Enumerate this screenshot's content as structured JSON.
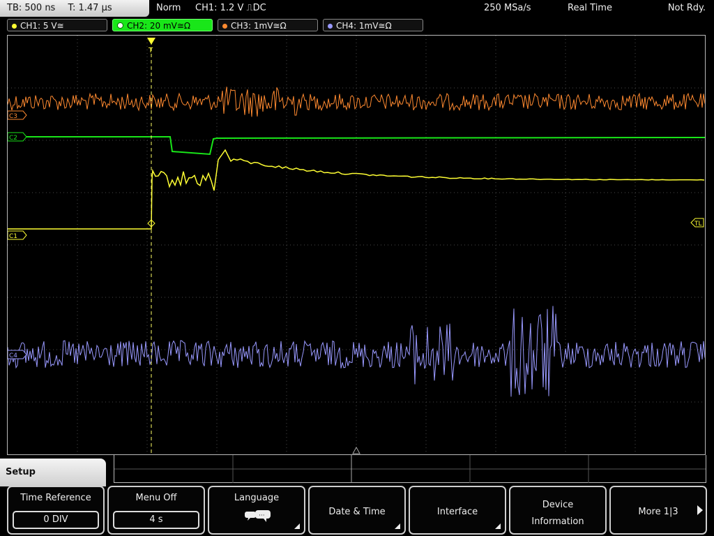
{
  "status": {
    "timebase": "TB: 500 ns",
    "time": "T: 1.47 µs",
    "mode": "Norm",
    "trigger": "CH1: 1.2 V ⎍DC",
    "sample_rate": "250 MSa/s",
    "acq_mode": "Real Time",
    "state": "Not Rdy."
  },
  "channels": [
    {
      "label": "CH1: 5 V≅",
      "color": "#ffff33"
    },
    {
      "label": "CH2: 20 mV≅Ω",
      "color": "#19e619"
    },
    {
      "label": "CH3: 1mV≅Ω",
      "color": "#ff8a30"
    },
    {
      "label": "CH4: 1mV≅Ω",
      "color": "#9999ff"
    }
  ],
  "markers": {
    "c3": "C3",
    "c2": "C2",
    "c1": "C1",
    "c4": "C4",
    "trigger_level": "TL",
    "trigger_position": "T"
  },
  "menu": {
    "title": "Setup",
    "softkeys": {
      "time_reference": {
        "label": "Time Reference",
        "value": "0 DIV"
      },
      "menu_off": {
        "label": "Menu Off",
        "value": "4 s"
      },
      "language": {
        "label": "Language",
        "icon": "speech-bubble-icon"
      },
      "date_time": {
        "label": "Date & Time"
      },
      "interface": {
        "label": "Interface"
      },
      "device_info": {
        "line1": "Device",
        "line2": "Information"
      },
      "more": {
        "label": "More 1|3"
      }
    }
  }
}
